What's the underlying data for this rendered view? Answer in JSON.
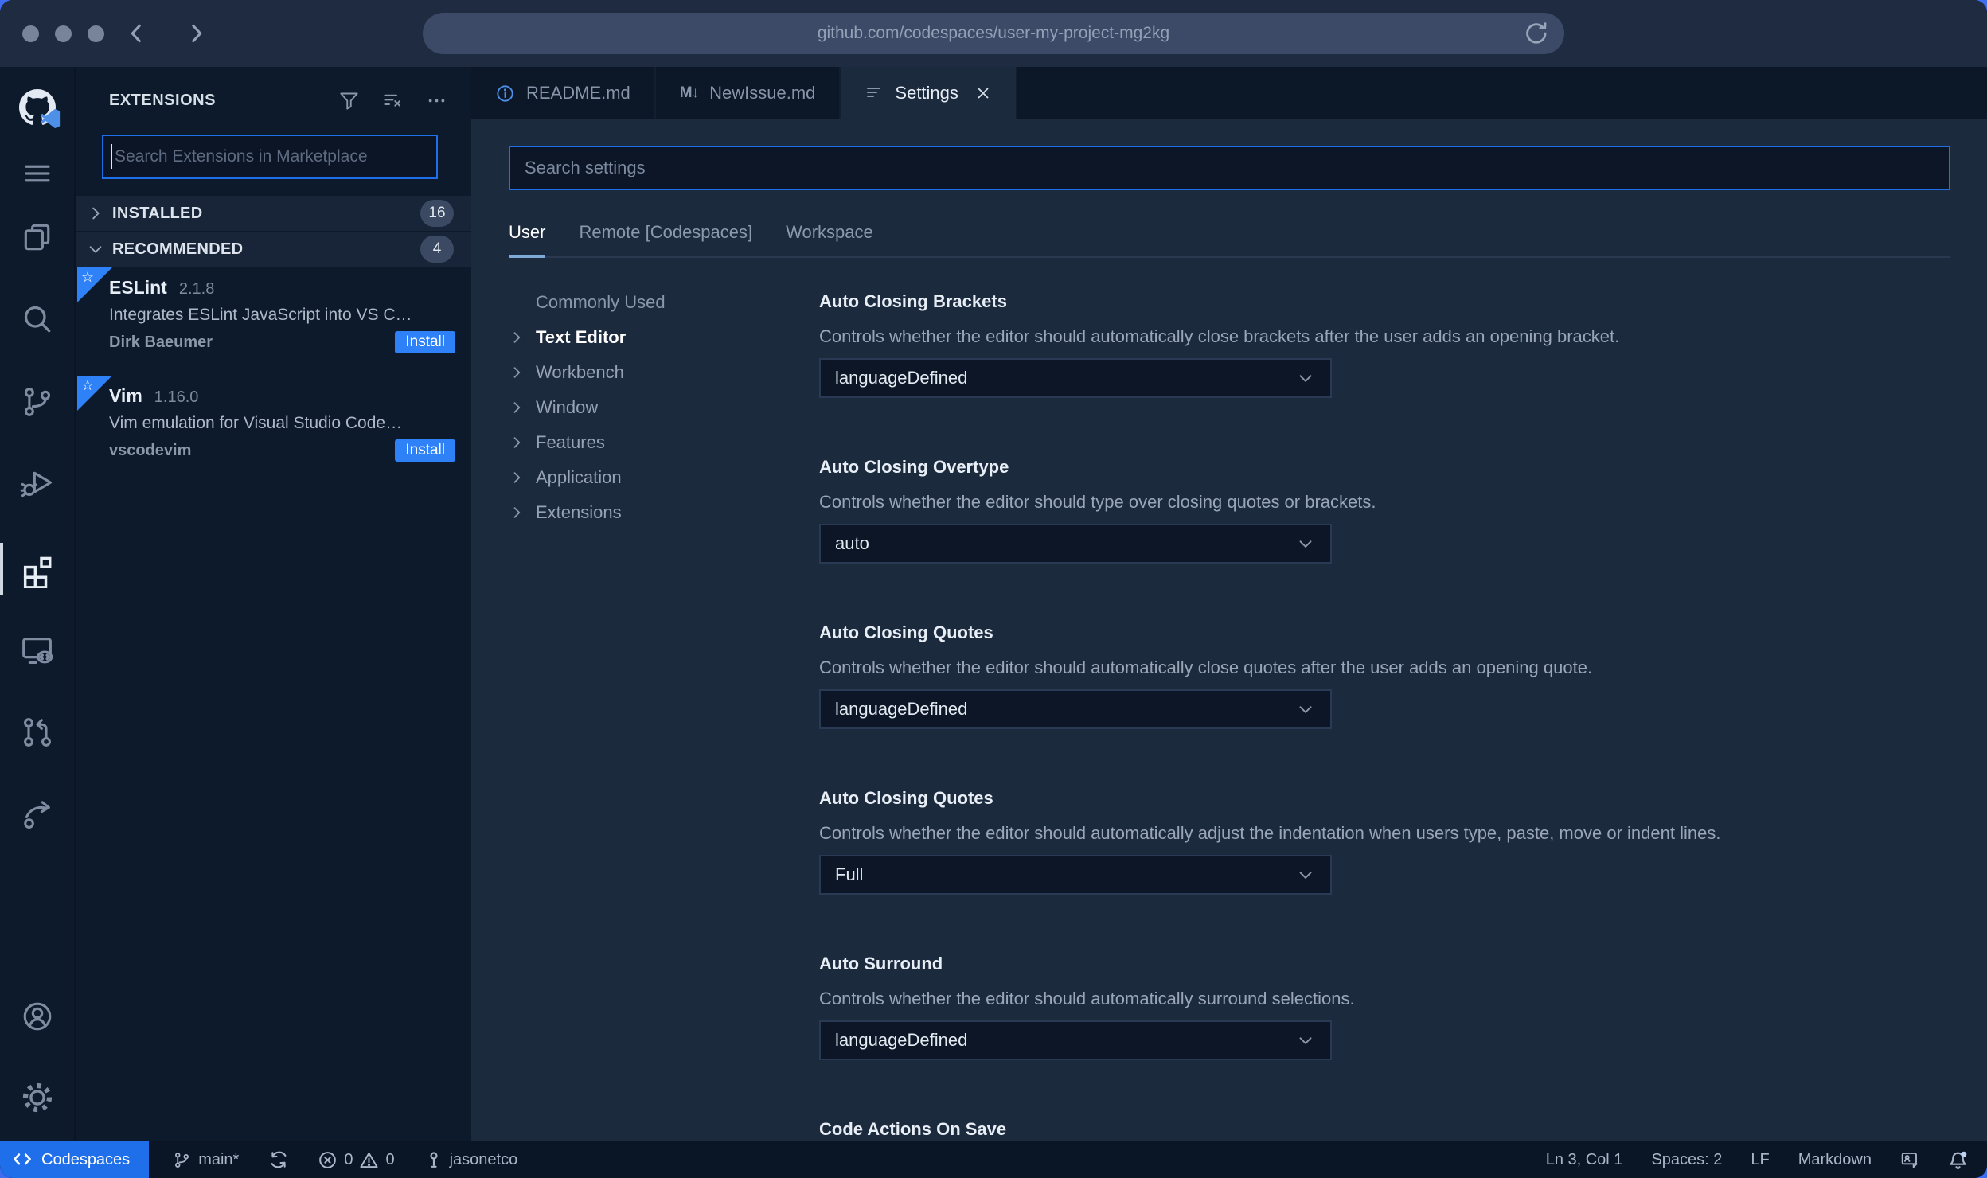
{
  "window": {
    "url": "github.com/codespaces/user-my-project-mg2kg"
  },
  "colors": {
    "desktop_blue": "#3f6df2",
    "accent_blue": "#2f81f7",
    "focus_border_blue": "#1f6feb",
    "status_remote_blue": "#1f6feb",
    "scope_underline": "#7fa9d6"
  },
  "icons": {
    "filter": "funnel outline",
    "clear_filter": "list with x",
    "more_actions": "ellipsis",
    "readme_tab": "blue circled i",
    "newissue_tab_glyph": "M↓",
    "settings_tab": "tune lines",
    "close": "x",
    "chevron_right": "›",
    "chevron_down": "⌄",
    "notification_bell": "bell with dot"
  },
  "sidebar": {
    "title": "EXTENSIONS",
    "search": {
      "placeholder": "Search Extensions in Marketplace"
    },
    "sections": [
      {
        "label": "INSTALLED",
        "count": "16",
        "state": "collapsed"
      },
      {
        "label": "RECOMMENDED",
        "count": "4",
        "state": "expanded"
      }
    ],
    "extensions": [
      {
        "name": "ESLint",
        "version": "2.1.8",
        "description": "Integrates ESLint JavaScript into VS C…",
        "author": "Dirk Baeumer",
        "action": "Install"
      },
      {
        "name": "Vim",
        "version": "1.16.0",
        "description": "Vim emulation for Visual Studio Code…",
        "author": "vscodevim",
        "action": "Install"
      }
    ]
  },
  "editor": {
    "tabs": [
      {
        "label": "README.md"
      },
      {
        "label": "NewIssue.md",
        "icon_text": "M↓"
      },
      {
        "label": "Settings",
        "active": true
      }
    ]
  },
  "settings_page": {
    "search_placeholder": "Search settings",
    "scopes": [
      "User",
      "Remote [Codespaces]",
      "Workspace"
    ],
    "toc": [
      "Commonly Used",
      "Text Editor",
      "Workbench",
      "Window",
      "Features",
      "Application",
      "Extensions"
    ],
    "rows": [
      {
        "title": "Auto Closing Brackets",
        "description": "Controls whether the editor should automatically close brackets after the user adds an opening bracket.",
        "value": "languageDefined"
      },
      {
        "title": "Auto Closing Overtype",
        "description": "Controls whether the editor should type over closing quotes or brackets.",
        "value": "auto"
      },
      {
        "title": "Auto Closing Quotes",
        "description": "Controls whether the editor should automatically close quotes after the user adds an opening quote.",
        "value": "languageDefined"
      },
      {
        "title": "Auto Closing Quotes",
        "description": "Controls whether the editor should automatically adjust the indentation when users type, paste, move or indent lines.",
        "value": "Full"
      },
      {
        "title": "Auto Surround",
        "description": "Controls whether the editor should automatically surround selections.",
        "value": "languageDefined"
      }
    ],
    "next_section_title": "Code Actions On Save"
  },
  "status_bar": {
    "codespaces": "Codespaces",
    "branch": "main*",
    "errors": "0",
    "warnings": "0",
    "user": "jasonetco",
    "cursor": "Ln 3, Col 1",
    "indentation": "Spaces: 2",
    "eol": "LF",
    "language": "Markdown"
  }
}
